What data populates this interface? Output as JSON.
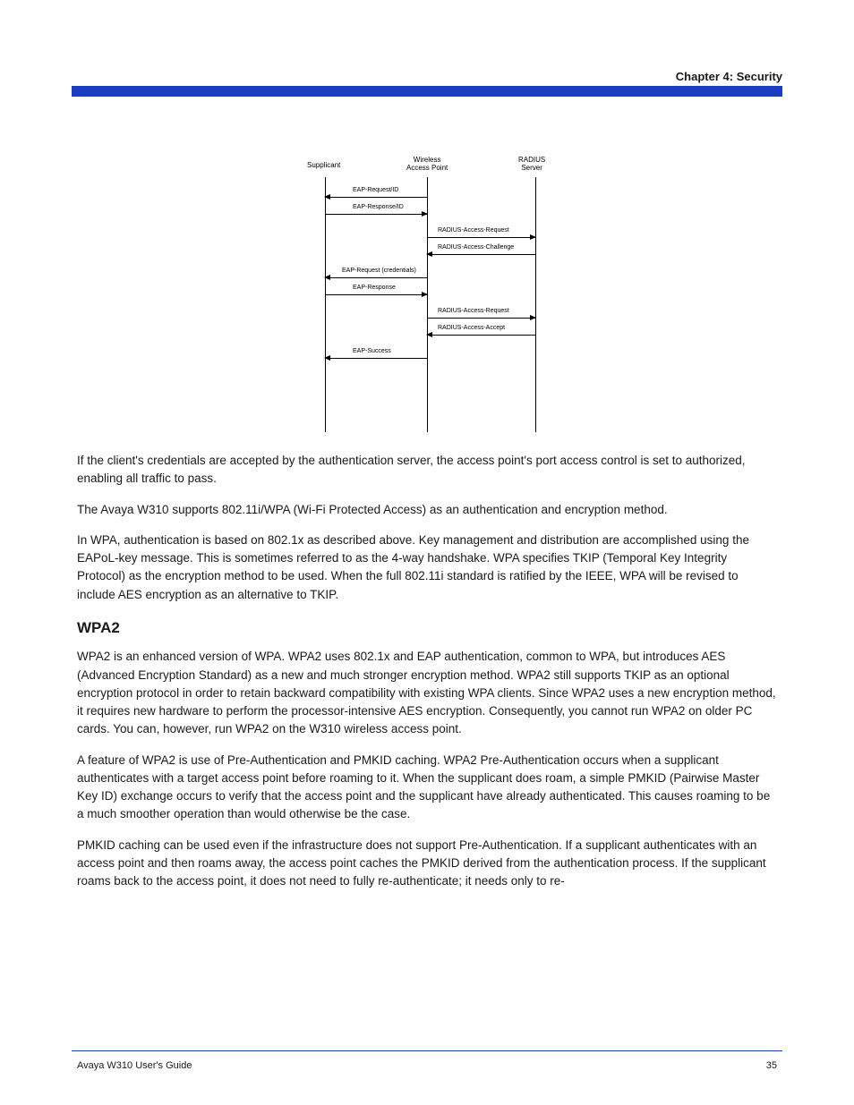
{
  "header": {
    "running_title": "Chapter 4: Security"
  },
  "diagram": {
    "actors": {
      "supplicant": "Supplicant",
      "ap": "Wireless\nAccess Point",
      "radius": "RADIUS\nServer"
    },
    "messages": {
      "m1": "EAP-Request/ID",
      "m2": "EAP-Response/ID",
      "m3": "RADIUS-Access-Request",
      "m4": "RADIUS-Access-Challenge",
      "m5": "EAP-Request (credentials)",
      "m6": "EAP-Response",
      "m7": "RADIUS-Access-Request",
      "m8": "RADIUS-Access-Accept",
      "m9": "EAP-Success"
    }
  },
  "body": {
    "p1": "If the client's credentials are accepted by the authentication server, the access point's port access control is set to authorized, enabling all traffic to pass.",
    "p2": "The Avaya W310 supports 802.11i/WPA (Wi-Fi Protected Access) as an authentication and encryption method.",
    "p3": "In WPA, authentication is based on 802.1x as described above. Key management and distribution are accomplished using the EAPoL-key message. This is sometimes referred to as the 4-way handshake. WPA specifies TKIP (Temporal Key Integrity Protocol) as the encryption method to be used. When the full 802.11i standard is ratified by the IEEE, WPA will be revised to include AES encryption as an alternative to TKIP.",
    "h_wpa2": "WPA2",
    "p4": "WPA2 is an enhanced version of WPA. WPA2 uses 802.1x and EAP authentication, common to WPA, but introduces AES (Advanced Encryption Standard) as a new and much stronger encryption method. WPA2 still supports TKIP as an optional encryption protocol in order to retain backward compatibility with existing WPA clients. Since WPA2 uses a new encryption method, it requires new hardware to perform the processor-intensive AES encryption. Consequently, you cannot run WPA2 on older PC cards. You can, however, run WPA2 on the W310 wireless access point.",
    "p5": "A feature of WPA2 is use of Pre-Authentication and PMKID caching. WPA2 Pre-Authentication occurs when a supplicant authenticates with a target access point before roaming to it. When the supplicant does roam, a simple PMKID (Pairwise Master Key ID) exchange occurs to verify that the access point and the supplicant have already authenticated. This causes roaming to be a much smoother operation than would otherwise be the case.",
    "p6": "PMKID caching can be used even if the infrastructure does not support Pre-Authentication. If a supplicant authenticates with an access point and then roams away, the access point caches the PMKID derived from the authentication process. If the supplicant roams back to the access point, it does not need to fully re-authenticate; it needs only to re-"
  },
  "footer": {
    "left": "Avaya W310 User's Guide",
    "right": "35"
  }
}
